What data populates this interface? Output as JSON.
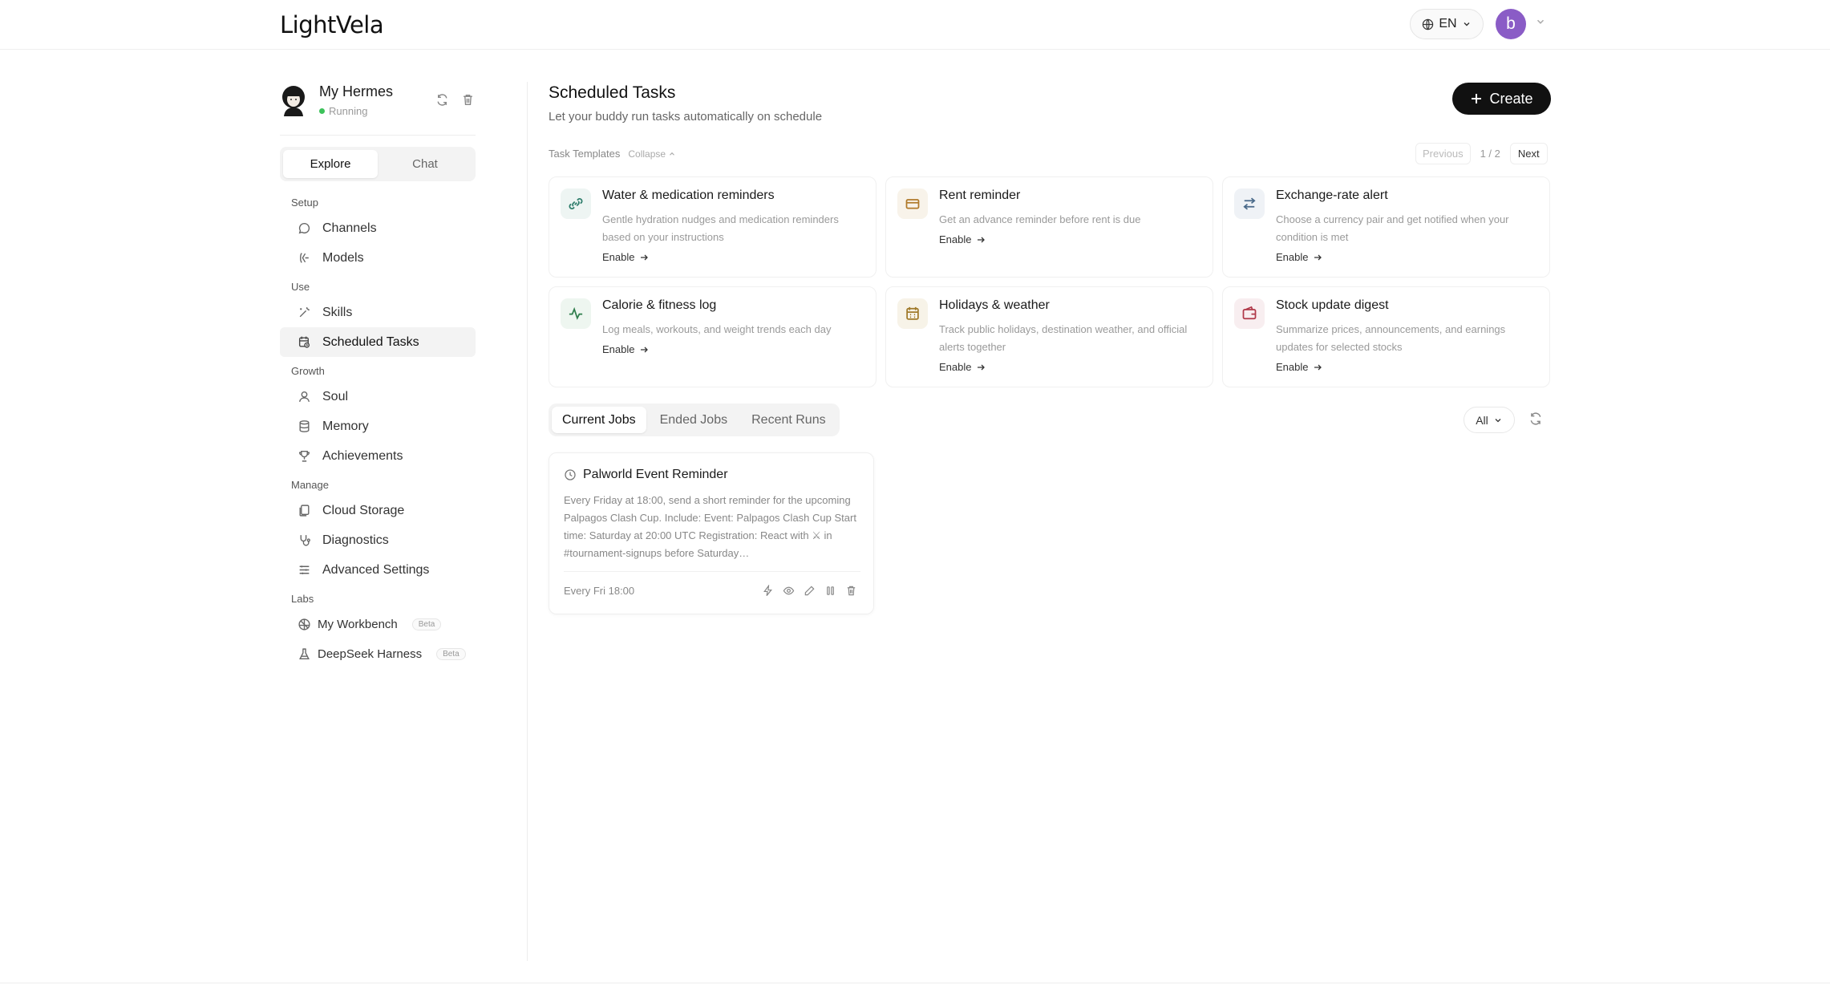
{
  "header": {
    "logo": "LightVela",
    "lang": "EN",
    "user_initial": "b"
  },
  "agent": {
    "name": "My Hermes",
    "status": "Running"
  },
  "sidebar_tabs": [
    "Explore",
    "Chat"
  ],
  "nav": {
    "setup": "Setup",
    "channels": "Channels",
    "models": "Models",
    "use": "Use",
    "skills": "Skills",
    "scheduled": "Scheduled Tasks",
    "growth": "Growth",
    "soul": "Soul",
    "memory": "Memory",
    "achievements": "Achievements",
    "manage": "Manage",
    "cloud": "Cloud Storage",
    "diagnostics": "Diagnostics",
    "advanced": "Advanced Settings",
    "labs": "Labs",
    "workbench": "My Workbench",
    "deepseek": "DeepSeek Harness",
    "beta": "Beta"
  },
  "main": {
    "title": "Scheduled Tasks",
    "subtitle": "Let your buddy run tasks automatically on schedule",
    "create": "Create",
    "templates_label": "Task Templates",
    "collapse": "Collapse",
    "pager": {
      "prev": "Previous",
      "count": "1 / 2",
      "next": "Next"
    },
    "enable": "Enable"
  },
  "templates": [
    {
      "title": "Water & medication reminders",
      "desc": "Gentle hydration nudges and medication reminders based on your instructions",
      "icon": "link-icon",
      "color": "#2e7d6b"
    },
    {
      "title": "Rent reminder",
      "desc": "Get an advance reminder before rent is due",
      "icon": "card-icon",
      "color": "#b07a2a"
    },
    {
      "title": "Exchange-rate alert",
      "desc": "Choose a currency pair and get notified when your condition is met",
      "icon": "swap-icon",
      "color": "#4a6a8a"
    },
    {
      "title": "Calorie & fitness log",
      "desc": "Log meals, workouts, and weight trends each day",
      "icon": "pulse-icon",
      "color": "#2e7d4b"
    },
    {
      "title": "Holidays & weather",
      "desc": "Track public holidays, destination weather, and official alerts together",
      "icon": "calendar-icon",
      "color": "#a07a2a"
    },
    {
      "title": "Stock update digest",
      "desc": "Summarize prices, announcements, and earnings updates for selected stocks",
      "icon": "wallet-icon",
      "color": "#b03a4a"
    }
  ],
  "job_tabs": [
    "Current Jobs",
    "Ended Jobs",
    "Recent Runs"
  ],
  "filter": "All",
  "job": {
    "title": "Palworld Event Reminder",
    "desc": "Every Friday at 18:00, send a short reminder for the upcoming Palpagos Clash Cup. Include: Event: Palpagos Clash Cup Start time: Saturday at 20:00 UTC Registration: React with ⚔ in #tournament-signups before Saturday…",
    "schedule": "Every Fri 18:00"
  }
}
